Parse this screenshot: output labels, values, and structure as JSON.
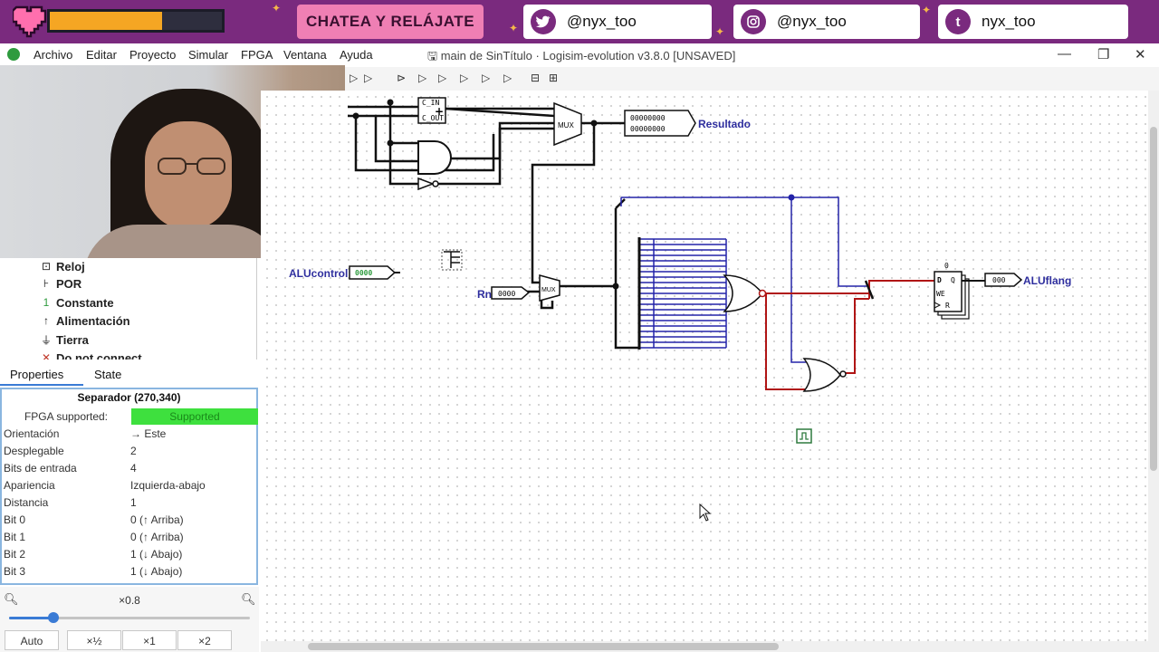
{
  "overlay": {
    "chat_label": "CHATEA Y RELÁJATE",
    "twitter_handle": "@nyx_too",
    "instagram_handle": "@nyx_too",
    "tumblr_handle": "nyx_too",
    "tumblr_icon_letter": "t",
    "hp_fraction": 0.65,
    "colors": {
      "bar": "#7a2a7e",
      "chat_pill": "#ef7fb4",
      "hp": "#f5a623"
    }
  },
  "window": {
    "title": "main de SinTítulo · Logisim-evolution v3.8.0 [UNSAVED]",
    "menu": [
      "Archivo",
      "Editar",
      "Proyecto",
      "Simular",
      "FPGA",
      "Ventana",
      "Ayuda"
    ]
  },
  "components": [
    {
      "label": "Reloj",
      "icon": "clock-icon"
    },
    {
      "label": "POR",
      "icon": "por-icon"
    },
    {
      "label": "Constante",
      "icon": "constant-icon"
    },
    {
      "label": "Alimentación",
      "icon": "power-icon"
    },
    {
      "label": "Tierra",
      "icon": "ground-icon"
    },
    {
      "label": "Do not connect",
      "icon": "no-connect-icon"
    }
  ],
  "tabs": {
    "properties": "Properties",
    "state": "State"
  },
  "properties": {
    "title": "Separador (270,340)",
    "fpga_key": "FPGA supported:",
    "fpga_value": "Supported",
    "rows": [
      {
        "key": "Orientación",
        "value": "→ Este"
      },
      {
        "key": "Desplegable",
        "value": "2"
      },
      {
        "key": "Bits de entrada",
        "value": "4"
      },
      {
        "key": "Apariencia",
        "value": "Izquierda-abajo"
      },
      {
        "key": "Distancia",
        "value": "1"
      },
      {
        "key": "Bit 0",
        "value": "0 (↑ Arriba)"
      },
      {
        "key": "Bit 1",
        "value": "0 (↑ Arriba)"
      },
      {
        "key": "Bit 2",
        "value": "1 (↓ Abajo)"
      },
      {
        "key": "Bit 3",
        "value": "1 (↓ Abajo)"
      }
    ]
  },
  "zoom": {
    "level": "×0.8",
    "slider_fraction": 0.19,
    "buttons": [
      "Auto",
      "×½",
      "×1",
      "×2"
    ]
  },
  "circuit": {
    "labels": {
      "resultado": "Resultado",
      "alucontrol": "ALUcontrol",
      "alucontrol_value": "0000",
      "rn": "Rn",
      "rn_value": "0000",
      "aluflang": "ALUflang",
      "aluflang_value": "000",
      "mux": "MUX",
      "resultado_value": "00000000",
      "reg_d": "D",
      "reg_q": "Q",
      "reg_we": "WE",
      "reg_r": "R",
      "reg_top": "0",
      "adder_top": "C_IN",
      "adder_bottom": "C_OUT"
    }
  }
}
